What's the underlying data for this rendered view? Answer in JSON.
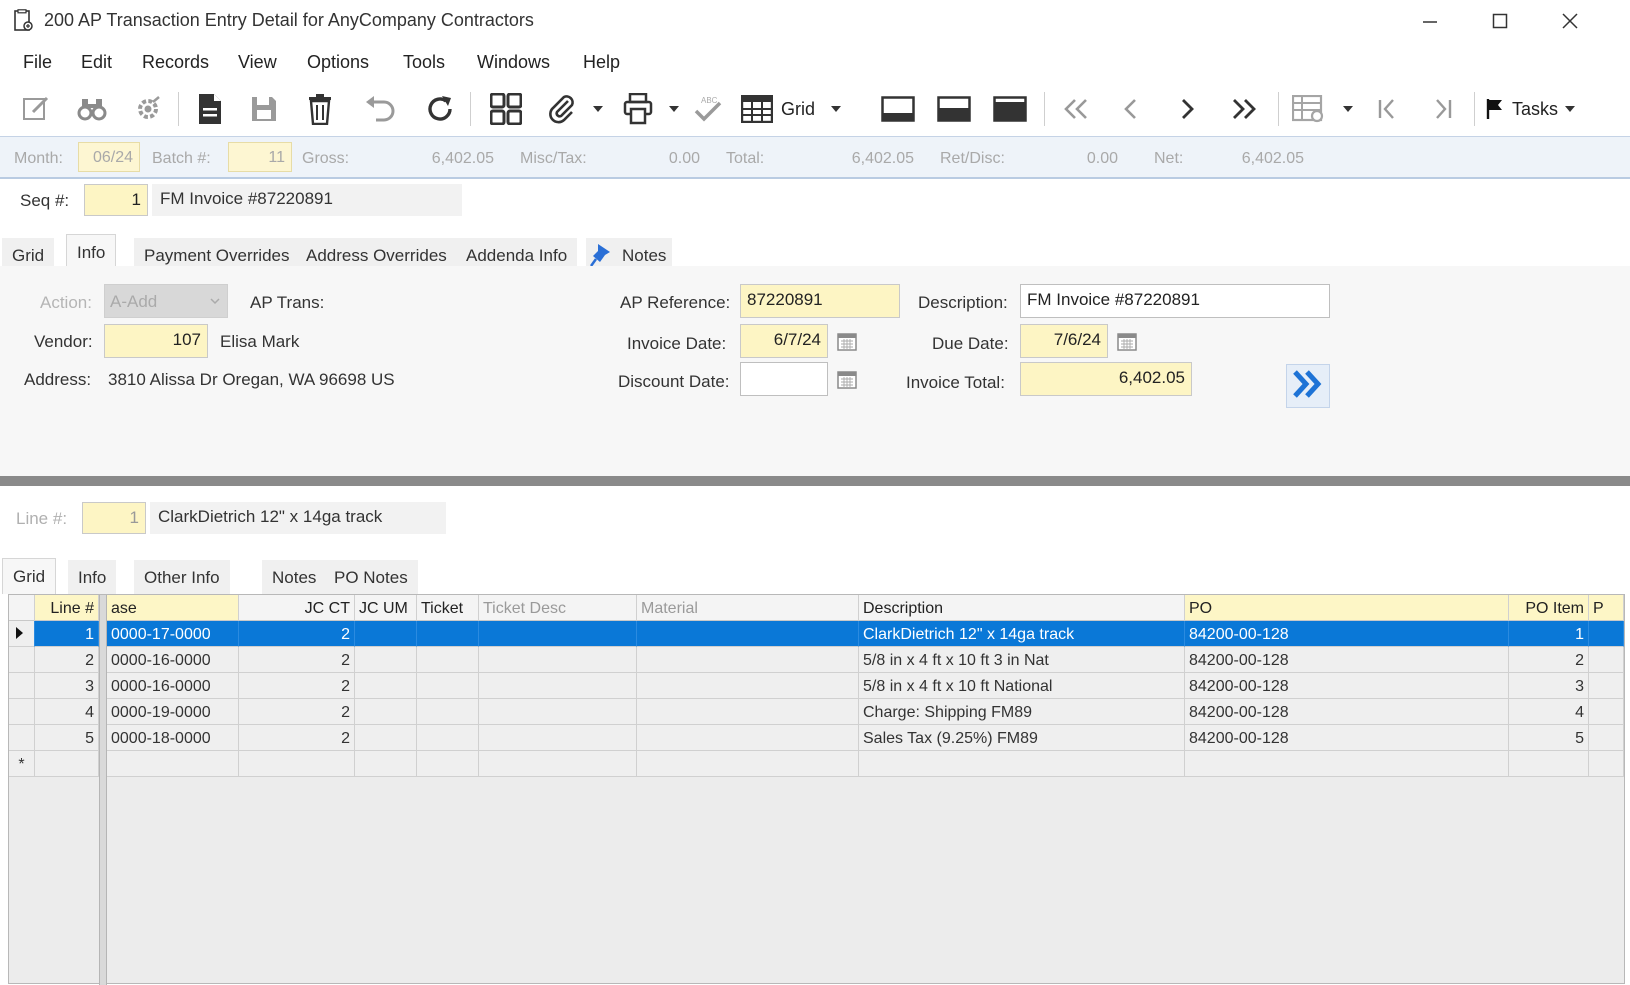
{
  "window": {
    "title": "200 AP Transaction Entry Detail for AnyCompany Contractors"
  },
  "menu": [
    "File",
    "Edit",
    "Records",
    "View",
    "Options",
    "Tools",
    "Windows",
    "Help"
  ],
  "toolbar": {
    "grid_label": "Grid",
    "tasks_label": "Tasks"
  },
  "batch": {
    "month_label": "Month:",
    "month_value": "06/24",
    "batch_label": "Batch #:",
    "batch_value": "11",
    "gross_label": "Gross:",
    "gross_value": "6,402.05",
    "misc_label": "Misc/Tax:",
    "misc_value": "0.00",
    "total_label": "Total:",
    "total_value": "6,402.05",
    "ret_label": "Ret/Disc:",
    "ret_value": "0.00",
    "net_label": "Net:",
    "net_value": "6,402.05"
  },
  "seq": {
    "label": "Seq #:",
    "value": "1",
    "description": "FM Invoice #87220891"
  },
  "header_tabs": [
    "Grid",
    "Info",
    "Payment Overrides",
    "Address Overrides",
    "Addenda Info",
    "Notes"
  ],
  "info": {
    "action_label": "Action:",
    "action_value": "A-Add",
    "ap_trans_label": "AP Trans:",
    "vendor_label": "Vendor:",
    "vendor_value": "107",
    "vendor_name": "Elisa Mark",
    "address_label": "Address:",
    "address_value": "3810 Alissa Dr  Oregan,  WA  96698  US",
    "ap_reference_label": "AP Reference:",
    "ap_reference_value": "87220891",
    "invoice_date_label": "Invoice Date:",
    "invoice_date_value": "6/7/24",
    "discount_date_label": "Discount Date:",
    "discount_date_value": "",
    "description_label": "Description:",
    "description_value": "FM Invoice #87220891",
    "due_date_label": "Due Date:",
    "due_date_value": "7/6/24",
    "invoice_total_label": "Invoice Total:",
    "invoice_total_value": "6,402.05"
  },
  "line": {
    "label": "Line #:",
    "value": "1",
    "description": "ClarkDietrich 12\" x 14ga track"
  },
  "line_tabs": [
    "Grid",
    "Info",
    "Other Info",
    "Notes",
    "PO Notes"
  ],
  "grid": {
    "columns": [
      "Line #",
      "ase",
      "JC CT",
      "JC UM",
      "Ticket",
      "Ticket Desc",
      "Material",
      "Description",
      "PO",
      "PO Item",
      "P"
    ],
    "rows": [
      {
        "line": "1",
        "phase": "0000-17-0000",
        "jcct": "2",
        "desc": "ClarkDietrich 12\" x 14ga track",
        "po": "84200-00-128",
        "item": "1"
      },
      {
        "line": "2",
        "phase": "0000-16-0000",
        "jcct": "2",
        "desc": "5/8 in x 4 ft x 10 ft 3 in Nat",
        "po": "84200-00-128",
        "item": "2"
      },
      {
        "line": "3",
        "phase": "0000-16-0000",
        "jcct": "2",
        "desc": "5/8 in x 4 ft x 10 ft National",
        "po": "84200-00-128",
        "item": "3"
      },
      {
        "line": "4",
        "phase": "0000-19-0000",
        "jcct": "2",
        "desc": "Charge: Shipping FM89",
        "po": "84200-00-128",
        "item": "4"
      },
      {
        "line": "5",
        "phase": "0000-18-0000",
        "jcct": "2",
        "desc": "Sales Tax (9.25%) FM89",
        "po": "84200-00-128",
        "item": "5"
      }
    ],
    "new_row_marker": "*",
    "selected_color": "#0a78d7"
  }
}
